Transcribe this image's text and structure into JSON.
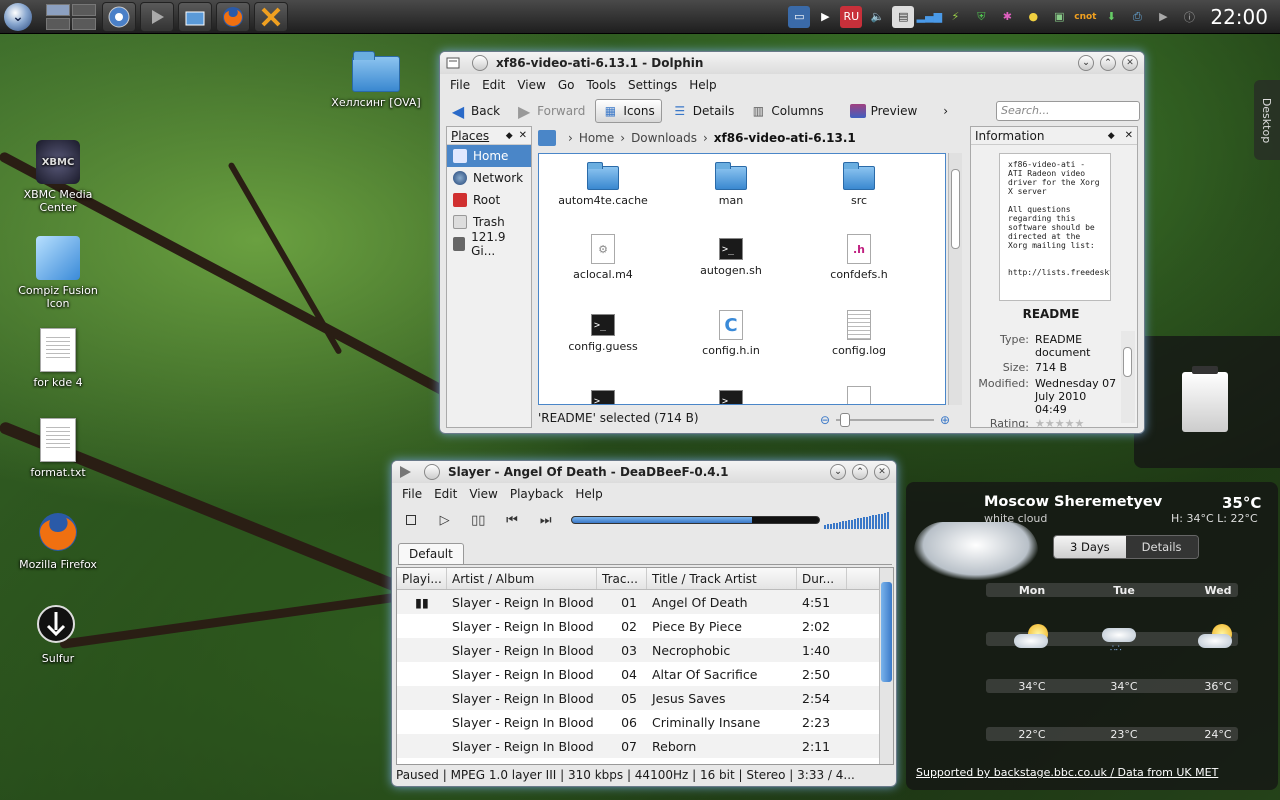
{
  "clock": "22:00",
  "panel": {
    "cnot_label": "cnot"
  },
  "desktop_tab": "Desktop",
  "desktop_icons": [
    {
      "label": "Хеллсинг [OVA]"
    },
    {
      "label": "XBMC Media Center"
    },
    {
      "label": "Compiz Fusion Icon"
    },
    {
      "label": "for kde 4"
    },
    {
      "label": "format.txt"
    },
    {
      "label": "Mozilla Firefox"
    },
    {
      "label": "Sulfur"
    }
  ],
  "xbmc_logo_text": "XBMC",
  "dolphin": {
    "title": "xf86-video-ati-6.13.1 - Dolphin",
    "menu": [
      "File",
      "Edit",
      "View",
      "Go",
      "Tools",
      "Settings",
      "Help"
    ],
    "toolbar": {
      "back": "Back",
      "forward": "Forward",
      "icons": "Icons",
      "details": "Details",
      "columns": "Columns",
      "preview": "Preview",
      "more": "›"
    },
    "search_placeholder": "Search...",
    "places_title": "Places",
    "places": [
      "Home",
      "Network",
      "Root",
      "Trash",
      "121.9 Gi..."
    ],
    "crumbs": [
      "Home",
      "Downloads",
      "xf86-video-ati-6.13.1"
    ],
    "files": [
      {
        "name": "autom4te.cache"
      },
      {
        "name": "man"
      },
      {
        "name": "src"
      },
      {
        "name": "aclocal.m4"
      },
      {
        "name": "autogen.sh",
        "glyph": ">_"
      },
      {
        "name": "confdefs.h",
        "glyph": ".h"
      },
      {
        "name": "config.guess",
        "glyph": ">_"
      },
      {
        "name": "config.h.in",
        "glyph": "C"
      },
      {
        "name": "config.log"
      }
    ],
    "terminal_glyph": ">_",
    "status": "'README' selected (714 B)",
    "info_title": "Information",
    "info_preview": "xf86-video-ati - ATI Radeon video driver for the Xorg X server\n\nAll questions regarding this software should be directed at the\nXorg mailing list:\n\n      http://lists.freedesktop.org/mailman/listinfo/xor",
    "info_filename": "README",
    "info_rows": [
      {
        "k": "Type:",
        "v": "README document"
      },
      {
        "k": "Size:",
        "v": "714 B"
      },
      {
        "k": "Modified:",
        "v": "Wednesday 07 July 2010 04:49"
      },
      {
        "k": "Rating:",
        "v": ""
      }
    ]
  },
  "player": {
    "title": "Slayer - Angel Of Death - DeaDBeeF-0.4.1",
    "menu": [
      "File",
      "Edit",
      "View",
      "Playback",
      "Help"
    ],
    "seek_fraction": 0.73,
    "tab": "Default",
    "columns": [
      "Playi...",
      "Artist / Album",
      "Trac...",
      "Title / Track Artist",
      "Dur..."
    ],
    "rows": [
      {
        "play": "▮▮",
        "artist": "Slayer - Reign In Blood",
        "track": "01",
        "title": "Angel Of Death",
        "dur": "4:51"
      },
      {
        "play": "",
        "artist": "Slayer - Reign In Blood",
        "track": "02",
        "title": "Piece By Piece",
        "dur": "2:02"
      },
      {
        "play": "",
        "artist": "Slayer - Reign In Blood",
        "track": "03",
        "title": "Necrophobic",
        "dur": "1:40"
      },
      {
        "play": "",
        "artist": "Slayer - Reign In Blood",
        "track": "04",
        "title": "Altar Of Sacrifice",
        "dur": "2:50"
      },
      {
        "play": "",
        "artist": "Slayer - Reign In Blood",
        "track": "05",
        "title": "Jesus Saves",
        "dur": "2:54"
      },
      {
        "play": "",
        "artist": "Slayer - Reign In Blood",
        "track": "06",
        "title": "Criminally Insane",
        "dur": "2:23"
      },
      {
        "play": "",
        "artist": "Slayer - Reign In Blood",
        "track": "07",
        "title": "Reborn",
        "dur": "2:11"
      }
    ],
    "status": "Paused | MPEG 1.0 layer III |  310 kbps | 44100Hz | 16 bit | Stereo | 3:33 / 4..."
  },
  "weather": {
    "city": "Moscow Sheremetyev",
    "condition": "white cloud",
    "temp": "35°C",
    "hilo": "H: 34°C  L: 22°C",
    "tab_days": "3 Days",
    "tab_details": "Details",
    "days": [
      {
        "name": "Mon",
        "high": "34°C",
        "low": "22°C"
      },
      {
        "name": "Tue",
        "high": "34°C",
        "low": "23°C"
      },
      {
        "name": "Wed",
        "high": "36°C",
        "low": "24°C"
      }
    ],
    "footer": "Supported by backstage.bbc.co.uk / Data from UK MET"
  }
}
